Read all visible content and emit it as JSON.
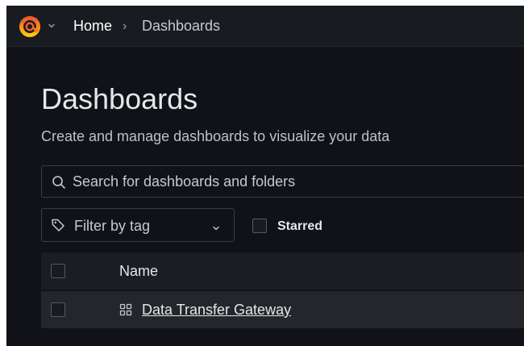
{
  "breadcrumb": {
    "home": "Home",
    "separator": "›",
    "current": "Dashboards"
  },
  "page": {
    "title": "Dashboards",
    "subtitle": "Create and manage dashboards to visualize your data"
  },
  "search": {
    "placeholder": "Search for dashboards and folders",
    "value": ""
  },
  "filters": {
    "tag_label": "Filter by tag",
    "starred_label": "Starred",
    "starred_checked": false
  },
  "table": {
    "columns": [
      "Name"
    ],
    "rows": [
      {
        "title": "Data Transfer Gateway",
        "icon": "dashboard-grid-icon"
      }
    ]
  },
  "colors": {
    "background": "#111217",
    "topbar": "#181b1f",
    "logo_orange": "#F05A28",
    "logo_yellow": "#FBCA0A"
  },
  "icons": [
    "grafana-logo-icon",
    "chevron-down-icon",
    "search-icon",
    "tag-icon",
    "dashboard-grid-icon"
  ]
}
